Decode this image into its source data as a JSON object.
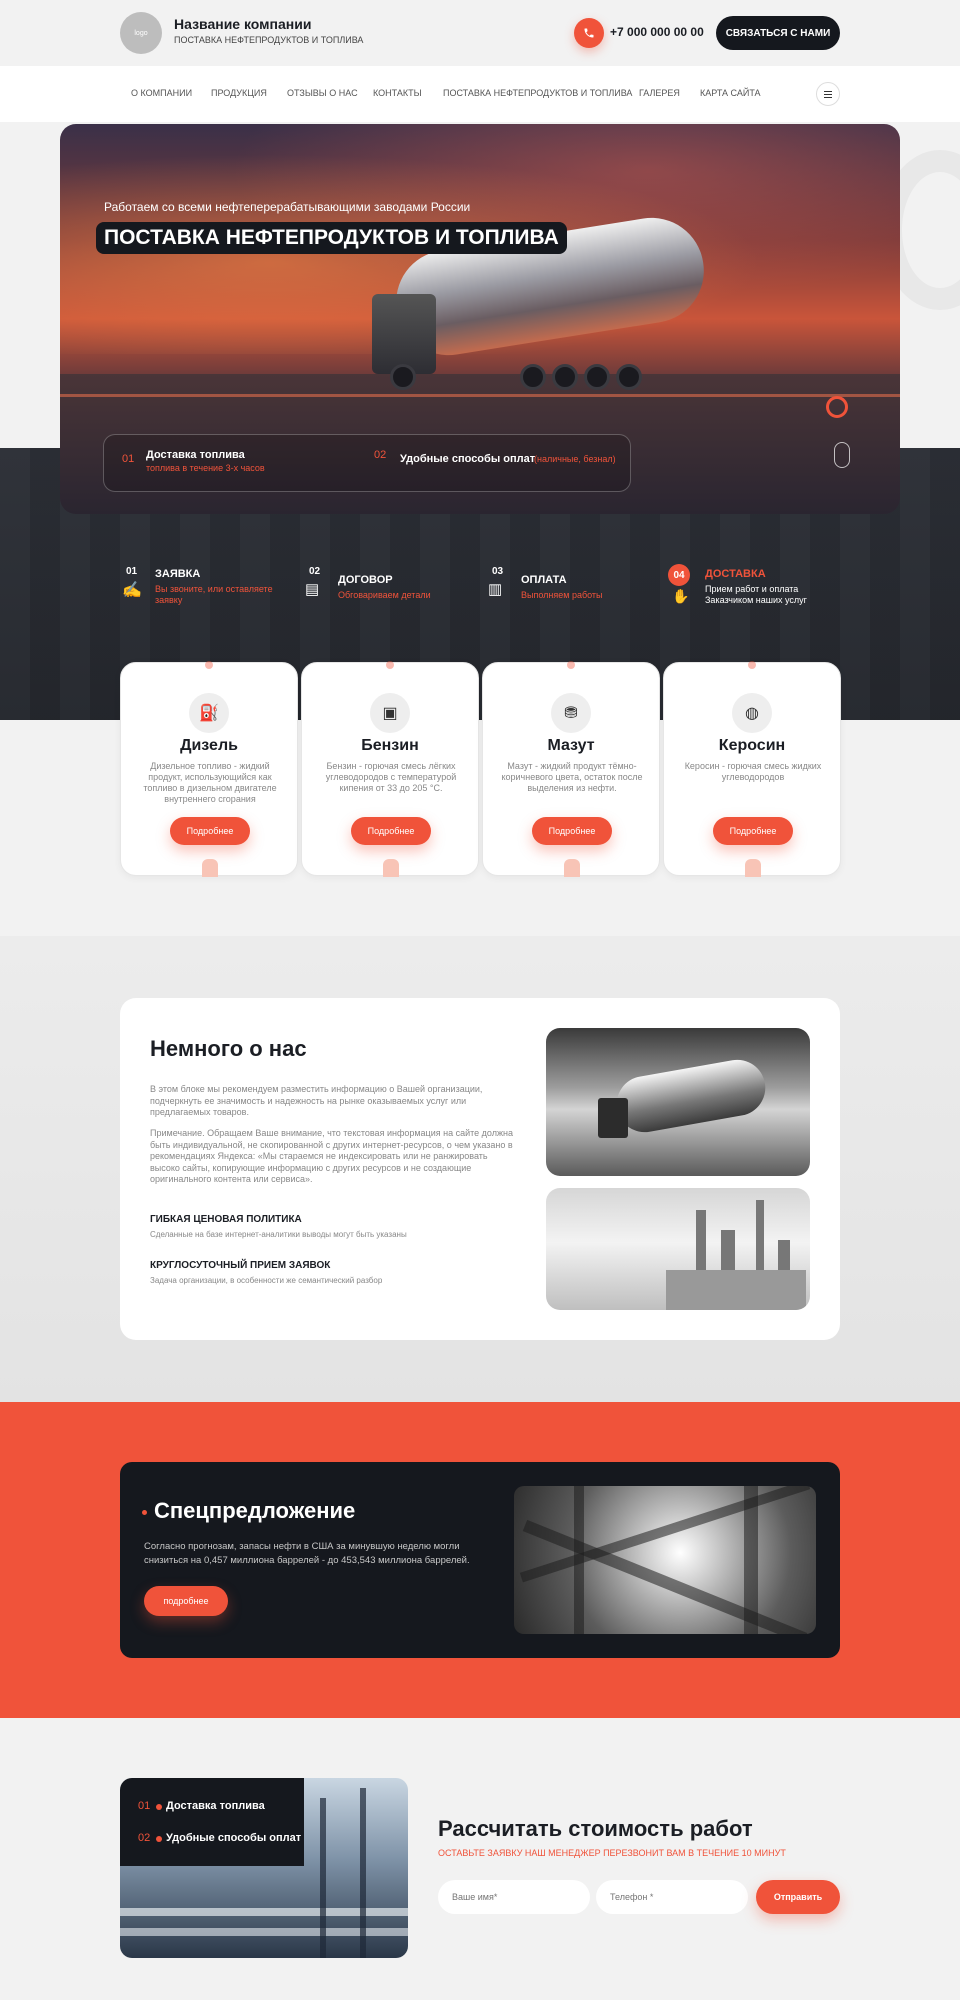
{
  "header": {
    "logo_text": "logo",
    "company_name": "Название компании",
    "company_sub": "ПОСТАВКА НЕФТЕПРОДУКТОВ И ТОПЛИВА",
    "phone": "+7 000 000 00 00",
    "contact_button": "СВЯЗАТЬСЯ С НАМИ"
  },
  "nav": {
    "items": [
      "О КОМПАНИИ",
      "ПРОДУКЦИЯ",
      "ОТЗЫВЫ О НАС",
      "КОНТАКТЫ",
      "ПОСТАВКА НЕФТЕПРОДУКТОВ И ТОПЛИВА",
      "ГАЛЕРЕЯ",
      "КАРТА САЙТА"
    ]
  },
  "hero": {
    "tagline": "Работаем со всеми нефтеперерабатывающими заводами России",
    "title": "ПОСТАВКА НЕФТЕПРОДУКТОВ И ТОПЛИВА",
    "features": [
      {
        "num": "01",
        "title": "Доставка топлива",
        "sub": "топлива в течение 3-х часов"
      },
      {
        "num": "02",
        "title": "Удобные способы оплат",
        "sub": "(наличные, безнал)"
      }
    ]
  },
  "steps": [
    {
      "num": "01",
      "title": "ЗАЯВКА",
      "sub": "Вы звоните, или оставляете заявку"
    },
    {
      "num": "02",
      "title": "ДОГОВОР",
      "sub": "Обговариваем детали"
    },
    {
      "num": "03",
      "title": "ОПЛАТА",
      "sub": "Выполняем работы"
    },
    {
      "num": "04",
      "title": "ДОСТАВКА",
      "sub": "Прием работ и оплата Заказчиком наших услуг"
    }
  ],
  "products": [
    {
      "name": "Дизель",
      "desc": "Дизельное топливо - жидкий продукт, использующийся как топливо в дизельном двигателе внутреннего сгорания",
      "button": "Подробнее"
    },
    {
      "name": "Бензин",
      "desc": "Бензин - горючая смесь лёгких углеводородов с температурой кипения от 33 до 205 °C.",
      "button": "Подробнее"
    },
    {
      "name": "Мазут",
      "desc": "Мазут - жидкий продукт тёмно-коричневого цвета, остаток после выделения из нефти.",
      "button": "Подробнее"
    },
    {
      "name": "Керосин",
      "desc": "Керосин - горючая смесь жидких углеводородов",
      "button": "Подробнее"
    }
  ],
  "about": {
    "title": "Немного о нас",
    "p1": "В этом блоке мы рекомендуем разместить информацию о Вашей организации, подчеркнуть ее значимость и надежность на рынке оказываемых услуг или предлагаемых товаров.",
    "p2": "Примечание. Обращаем Ваше внимание, что текстовая информация на сайте должна быть индивидуальной, не скопированной с других интернет-ресурсов, о чем указано в рекомендациях Яндекса: «Мы стараемся не индексировать или не ранжировать высоко сайты, копирующие информацию с других ресурсов и не создающие оригинального контента или сервиса».",
    "h1": "ГИБКАЯ ЦЕНОВАЯ ПОЛИТИКА",
    "h1_sub": "Сделанные на базе интернет-аналитики выводы могут быть указаны",
    "h2": "КРУГЛОСУТОЧНЫЙ ПРИЕМ ЗАЯВОК",
    "h2_sub": "Задача организации, в особенности же семантический разбор"
  },
  "offer": {
    "title": "Спецпредложение",
    "text": "Согласно прогнозам, запасы нефти в США за минувшую неделю могли снизиться на 0,457 миллиона баррелей - до 453,543 миллиона баррелей.",
    "button": "подробнее"
  },
  "calc": {
    "features": [
      {
        "num": "01",
        "title": "Доставка топлива"
      },
      {
        "num": "02",
        "title": "Удобные способы оплат"
      }
    ],
    "title": "Рассчитать стоимость работ",
    "sub": "ОСТАВЬТЕ ЗАЯВКУ НАШ МЕНЕДЖЕР ПЕРЕЗВОНИТ ВАМ В ТЕЧЕНИЕ 10 МИНУТ",
    "name_placeholder": "Ваше имя*",
    "phone_placeholder": "Телефон *",
    "submit": "Отправить"
  },
  "colors": {
    "accent": "#f0533a",
    "dark": "#15181e",
    "light": "#f2f2f2"
  }
}
